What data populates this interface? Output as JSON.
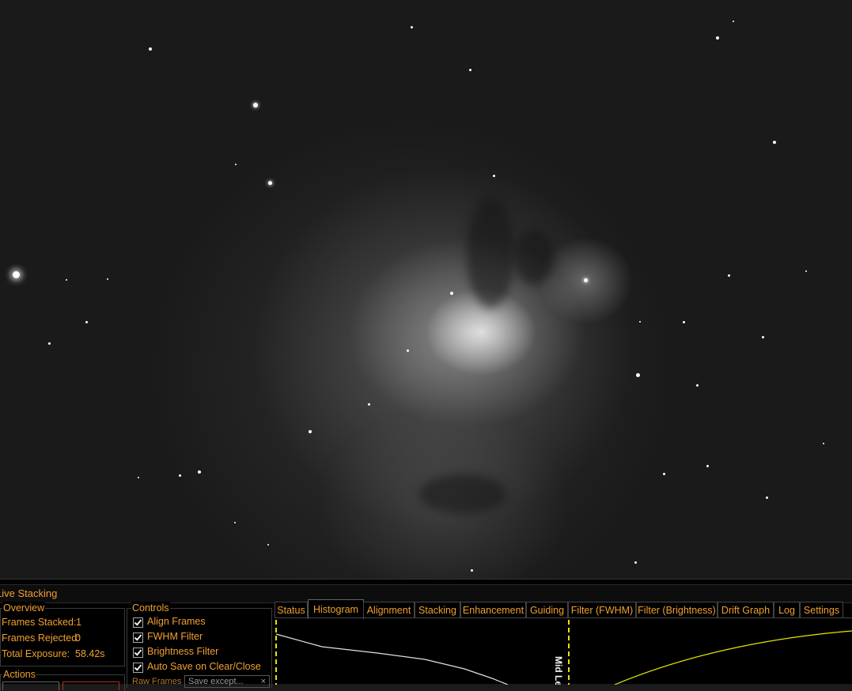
{
  "panel": {
    "title": "Live Stacking",
    "overview": {
      "title": "Overview",
      "frames_stacked_label": "Frames Stacked:",
      "frames_stacked_value": "1",
      "frames_rejected_label": "Frames Rejected:",
      "frames_rejected_value": "0",
      "total_exposure_label": "Total Exposure:",
      "total_exposure_value": "58.42s"
    },
    "actions": {
      "title": "Actions"
    },
    "controls": {
      "title": "Controls",
      "align_frames": "Align Frames",
      "fwhm_filter": "FWHM Filter",
      "brightness_filter": "Brightness Filter",
      "auto_save": "Auto Save on Clear/Close",
      "raw_frames_label": "Raw Frames",
      "raw_frames_value": "Save except..."
    },
    "tabs": [
      "Status",
      "Histogram",
      "Alignment",
      "Stacking",
      "Enhancement",
      "Guiding",
      "Filter (FWHM)",
      "Filter (Brightness)",
      "Drift Graph",
      "Log",
      "Settings"
    ],
    "active_tab": "Histogram",
    "histogram": {
      "marker_label": "Mid Le"
    }
  },
  "colors": {
    "accent": "#f0a030",
    "histogram_curve": "#e0e0e0",
    "stretch_curve": "#e6e600",
    "marker": "#f0e000"
  },
  "icons": {
    "checkbox": "check-icon",
    "dropdown": "close-icon"
  }
}
